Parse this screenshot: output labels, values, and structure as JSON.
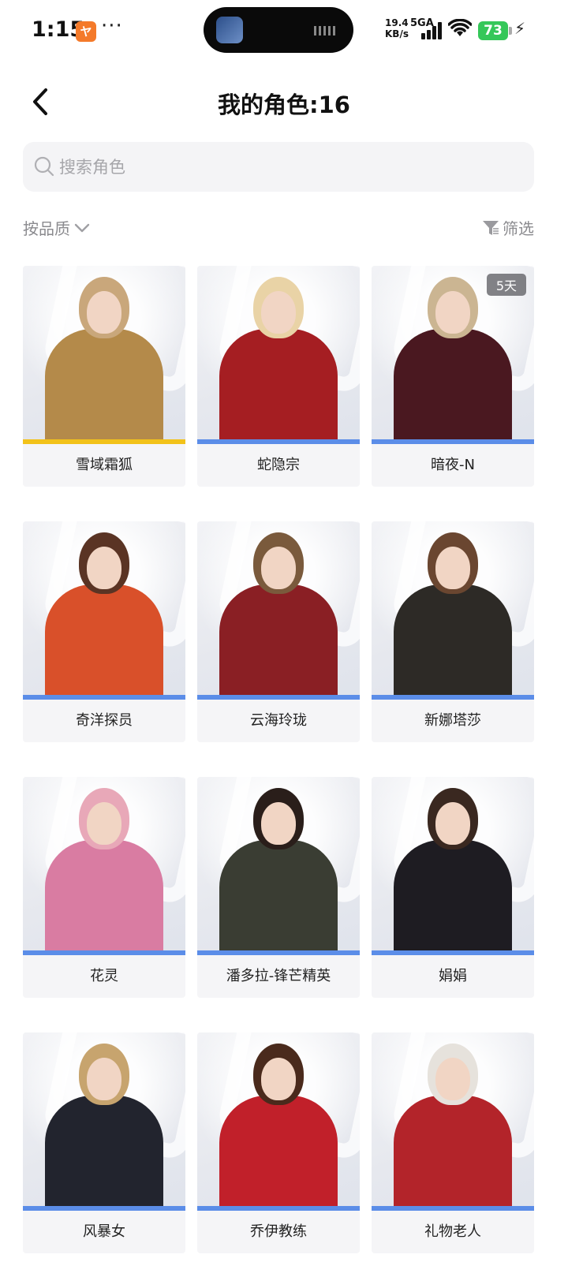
{
  "status_bar": {
    "time": "1:15",
    "app_badge": "ヤ",
    "more": "···",
    "net_speed_value": "19.4",
    "net_speed_unit": "KB/s",
    "net_type": "5GA",
    "battery": "73"
  },
  "header": {
    "title": "我的角色:16"
  },
  "search": {
    "placeholder": "搜索角色"
  },
  "filters": {
    "sort_label": "按品质",
    "filter_label": "筛选"
  },
  "colors": {
    "accent_blue": "#5b8de8",
    "accent_gold": "#f2c21a",
    "battery_green": "#35c759"
  },
  "characters": [
    {
      "name": "雪域霜狐",
      "badge": "",
      "rarity_color": "#f2c21a",
      "hair": "#c9a77b",
      "outfit": "#b48a4a"
    },
    {
      "name": "蛇隐宗",
      "badge": "",
      "rarity_color": "#5b8de8",
      "hair": "#e9d3a6",
      "outfit": "#a51e22"
    },
    {
      "name": "暗夜-N",
      "badge": "5天",
      "rarity_color": "#5b8de8",
      "hair": "#cbb592",
      "outfit": "#4a1820"
    },
    {
      "name": "奇洋探员",
      "badge": "",
      "rarity_color": "#5b8de8",
      "hair": "#5a3424",
      "outfit": "#d9502a"
    },
    {
      "name": "云海玲珑",
      "badge": "",
      "rarity_color": "#5b8de8",
      "hair": "#7a5a3c",
      "outfit": "#8a1f24"
    },
    {
      "name": "新娜塔莎",
      "badge": "",
      "rarity_color": "#5b8de8",
      "hair": "#6a4630",
      "outfit": "#2d2a26"
    },
    {
      "name": "花灵",
      "badge": "",
      "rarity_color": "#5b8de8",
      "hair": "#e8a8b8",
      "outfit": "#d97ca2"
    },
    {
      "name": "潘多拉-锋芒精英",
      "badge": "",
      "rarity_color": "#5b8de8",
      "hair": "#2a1e1a",
      "outfit": "#3a3d33"
    },
    {
      "name": "娟娟",
      "badge": "",
      "rarity_color": "#5b8de8",
      "hair": "#3a2820",
      "outfit": "#1e1c22"
    },
    {
      "name": "风暴女",
      "badge": "",
      "rarity_color": "#5b8de8",
      "hair": "#c7a46e",
      "outfit": "#22242e"
    },
    {
      "name": "乔伊教练",
      "badge": "",
      "rarity_color": "#5b8de8",
      "hair": "#4a2a1c",
      "outfit": "#c1202a"
    },
    {
      "name": "礼物老人",
      "badge": "",
      "rarity_color": "#5b8de8",
      "hair": "#e6e2dc",
      "outfit": "#b3242a"
    }
  ]
}
